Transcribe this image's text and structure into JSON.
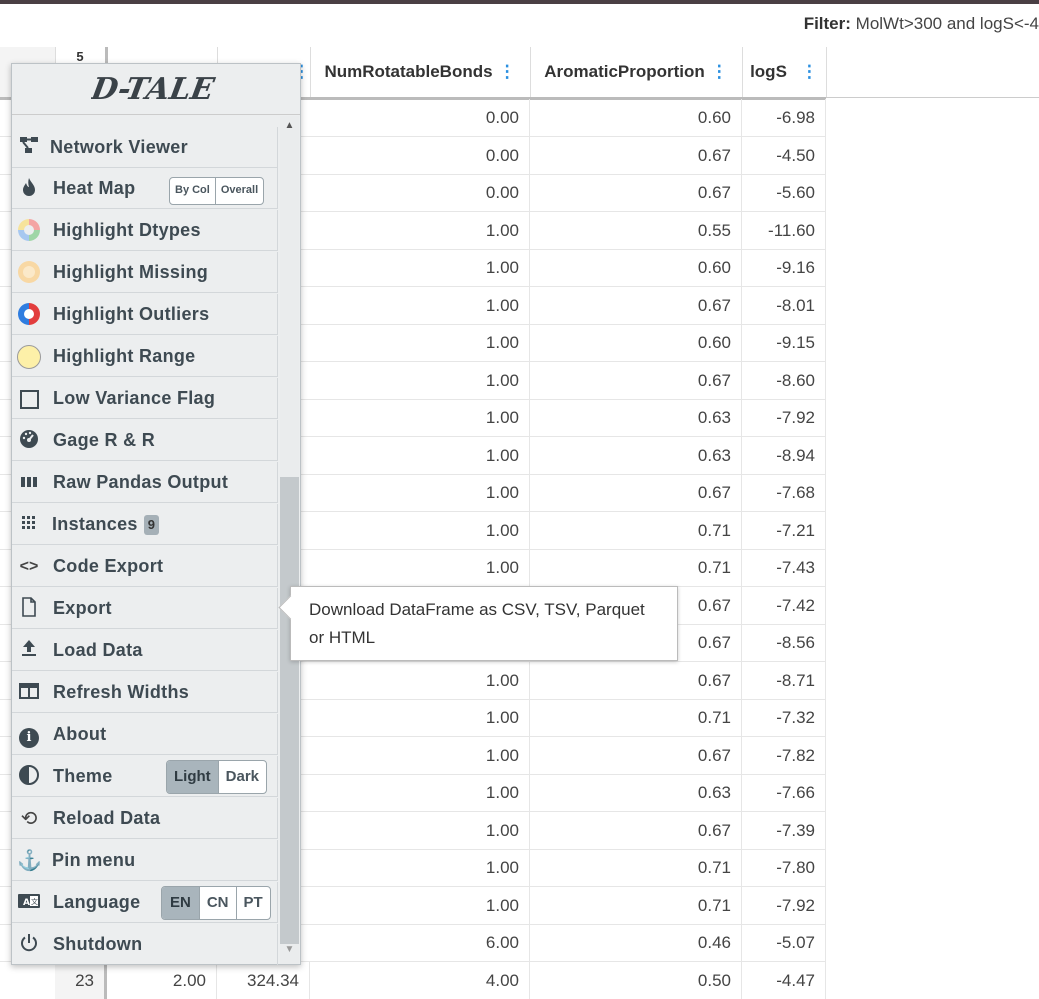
{
  "filter": {
    "label": "Filter:",
    "value": "MolWt>300 and logS<-4"
  },
  "header": {
    "index_top": "5",
    "col_num_rot": "NumRotatableBonds",
    "col_aromatic": "AromaticProportion",
    "col_logs": "logS"
  },
  "rows": [
    {
      "nrb": "0.00",
      "ap": "0.60",
      "logs": "-6.98"
    },
    {
      "nrb": "0.00",
      "ap": "0.67",
      "logs": "-4.50"
    },
    {
      "nrb": "0.00",
      "ap": "0.67",
      "logs": "-5.60"
    },
    {
      "nrb": "1.00",
      "ap": "0.55",
      "logs": "-11.60"
    },
    {
      "nrb": "1.00",
      "ap": "0.60",
      "logs": "-9.16"
    },
    {
      "nrb": "1.00",
      "ap": "0.67",
      "logs": "-8.01"
    },
    {
      "nrb": "1.00",
      "ap": "0.60",
      "logs": "-9.15"
    },
    {
      "nrb": "1.00",
      "ap": "0.67",
      "logs": "-8.60"
    },
    {
      "nrb": "1.00",
      "ap": "0.63",
      "logs": "-7.92"
    },
    {
      "nrb": "1.00",
      "ap": "0.63",
      "logs": "-8.94"
    },
    {
      "nrb": "1.00",
      "ap": "0.67",
      "logs": "-7.68"
    },
    {
      "nrb": "1.00",
      "ap": "0.71",
      "logs": "-7.21"
    },
    {
      "nrb": "1.00",
      "ap": "0.71",
      "logs": "-7.43"
    },
    {
      "nrb": "",
      "ap": "0.67",
      "logs": "-7.42"
    },
    {
      "nrb": "",
      "ap": "0.67",
      "logs": "-8.56"
    },
    {
      "nrb": "1.00",
      "ap": "0.67",
      "logs": "-8.71"
    },
    {
      "nrb": "1.00",
      "ap": "0.71",
      "logs": "-7.32"
    },
    {
      "nrb": "1.00",
      "ap": "0.67",
      "logs": "-7.82"
    },
    {
      "nrb": "1.00",
      "ap": "0.63",
      "logs": "-7.66"
    },
    {
      "nrb": "1.00",
      "ap": "0.67",
      "logs": "-7.39"
    },
    {
      "nrb": "1.00",
      "ap": "0.71",
      "logs": "-7.80"
    },
    {
      "nrb": "1.00",
      "ap": "0.71",
      "logs": "-7.92"
    },
    {
      "nrb": "6.00",
      "ap": "0.46",
      "logs": "-5.07"
    }
  ],
  "last_row": {
    "index": "23",
    "c1": "2.00",
    "c2": "324.34",
    "nrb": "4.00",
    "ap": "0.50",
    "logs": "-4.47"
  },
  "menu": {
    "logo": "D-TALE",
    "items": [
      {
        "label": "Network Viewer"
      },
      {
        "label": "Heat Map",
        "buttons": [
          "By Col",
          "Overall"
        ]
      },
      {
        "label": "Highlight Dtypes"
      },
      {
        "label": "Highlight Missing"
      },
      {
        "label": "Highlight Outliers"
      },
      {
        "label": "Highlight Range"
      },
      {
        "label": "Low Variance Flag"
      },
      {
        "label": "Gage R & R"
      },
      {
        "label": "Raw Pandas Output"
      },
      {
        "label": "Instances",
        "badge": "9"
      },
      {
        "label": "Code Export"
      },
      {
        "label": "Export"
      },
      {
        "label": "Load Data"
      },
      {
        "label": "Refresh Widths"
      },
      {
        "label": "About"
      },
      {
        "label": "Theme",
        "buttons": [
          "Light",
          "Dark"
        ]
      },
      {
        "label": "Reload Data"
      },
      {
        "label": "Pin menu"
      },
      {
        "label": "Language",
        "buttons": [
          "EN",
          "CN",
          "PT"
        ]
      },
      {
        "label": "Shutdown"
      }
    ]
  },
  "tooltip": {
    "text": "Download DataFrame as CSV, TSV, Parquet or HTML"
  },
  "colors": {
    "accent": "#2a8fe0",
    "menu_bg": "#eceeef",
    "active_btn": "#a9b5bc"
  }
}
